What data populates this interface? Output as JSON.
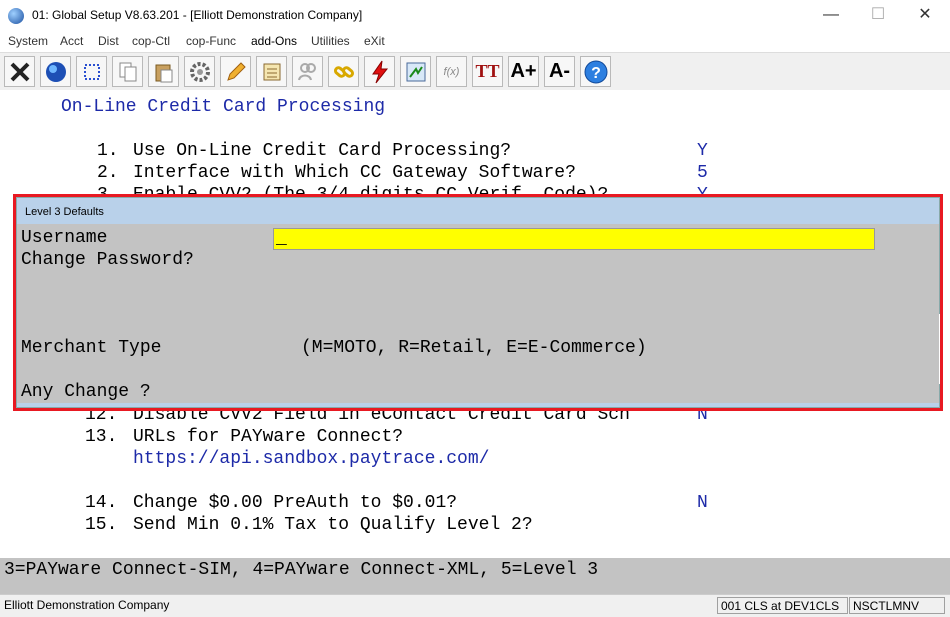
{
  "window": {
    "title": "01: Global Setup V8.63.201 - [Elliott Demonstration Company]",
    "controls": {
      "minimize": "—",
      "maximize": "☐",
      "close": "✕"
    }
  },
  "menu": [
    "System",
    "Acct",
    "Dist",
    "cop-Ctl",
    "cop-Func",
    "add-Ons",
    "Utilities",
    "eXit"
  ],
  "toolbar": {
    "icons": [
      "close-x-icon",
      "globe-icon",
      "select-icon",
      "copy-icon",
      "paste-icon",
      "settings-gear-icon",
      "edit-pencil-icon",
      "notes-icon",
      "users-icon",
      "link-icon",
      "lightning-icon",
      "calculator-icon",
      "function-icon",
      "font-icon",
      "font-increase-icon",
      "font-decrease-icon",
      "help-icon"
    ],
    "labels": {
      "font": "TT",
      "font_increase": "A+",
      "font_decrease": "A-",
      "help": "?",
      "function": "f(x)"
    }
  },
  "screen": {
    "heading": "On-Line Credit Card Processing",
    "items": [
      {
        "num": "1.",
        "text": "Use On-Line Credit Card Processing?",
        "value": "Y"
      },
      {
        "num": "2.",
        "text": "Interface with Which CC Gateway Software?",
        "value": "5"
      },
      {
        "num": "3.",
        "text": "Enable CVV2 (The 3/4 digits CC Verif. Code)?",
        "value": "Y"
      },
      {
        "num": "12.",
        "text": "Disable CVV2 Field in eContact Credit Card Scn",
        "value": "N"
      },
      {
        "num": "13.",
        "text": "URLs for PAYware Connect?",
        "value": ""
      },
      {
        "num": "",
        "text": "https://api.sandbox.paytrace.com/",
        "value": ""
      },
      {
        "num": "14.",
        "text": "Change $0.00 PreAuth to $0.01?",
        "value": "N"
      },
      {
        "num": "15.",
        "text": "Send Min 0.1% Tax to Qualify Level 2?",
        "value": ""
      }
    ]
  },
  "dialog": {
    "title": "Level 3 Defaults",
    "username_label": "Username",
    "username_value": "_",
    "change_password_label": "Change Password?",
    "merchant_type_label": "Merchant Type",
    "merchant_type_hint": "(M=MOTO, R=Retail, E=E-Commerce)",
    "any_change_label": "Any Change ?"
  },
  "helpline": "3=PAYware Connect-SIM, 4=PAYware Connect-XML, 5=Level 3",
  "statusbar": {
    "company": "Elliott Demonstration Company",
    "session": "001 CLS at DEV1CLS",
    "terminal": "NSCTLMNV"
  }
}
